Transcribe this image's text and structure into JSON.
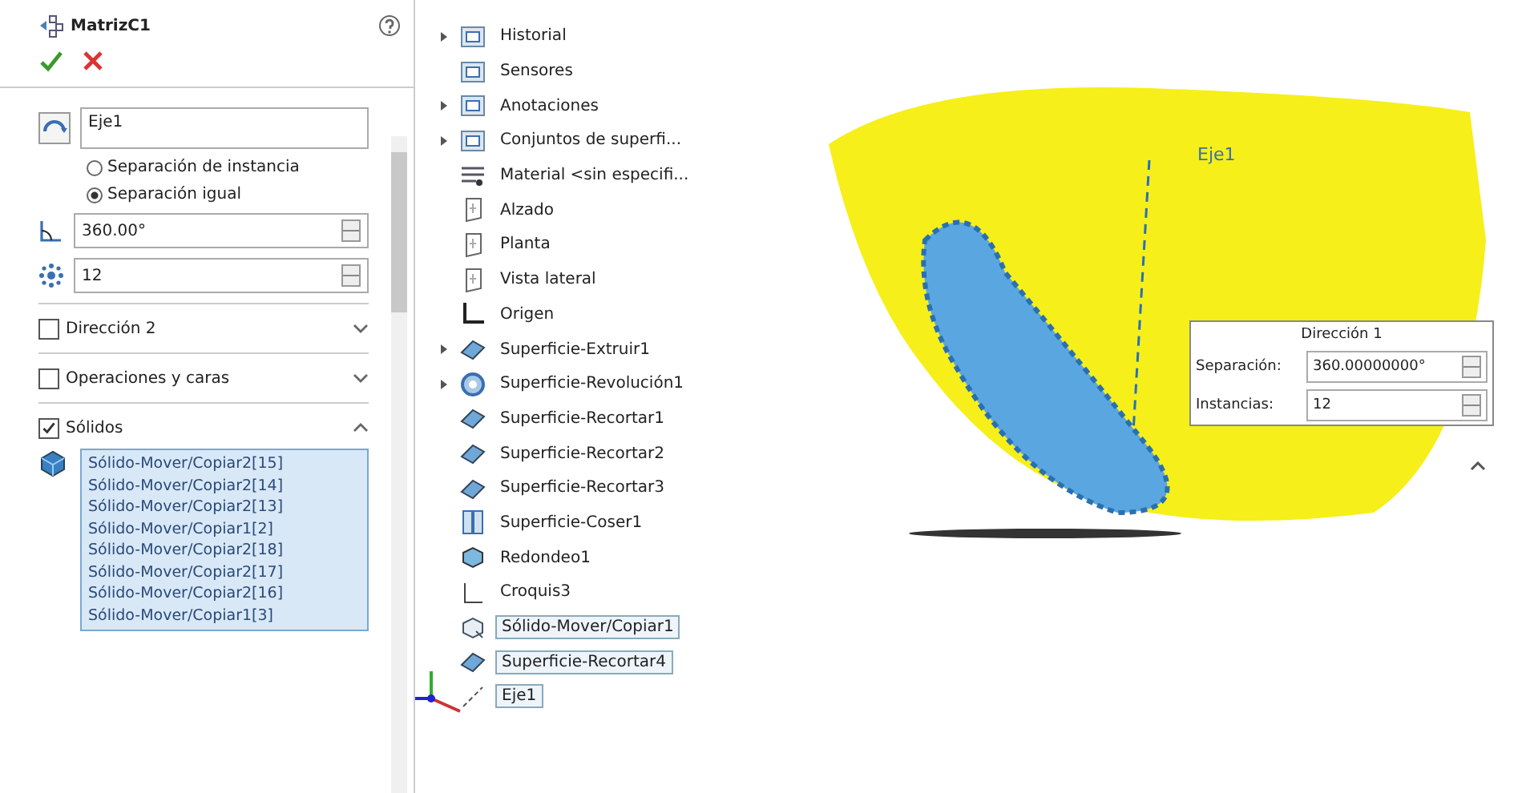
{
  "panel": {
    "title": "MatrizC1",
    "axis_field": {
      "value": "Eje1"
    },
    "radios": [
      {
        "label": "Separación de instancia",
        "selected": false
      },
      {
        "label": "Separación igual",
        "selected": true
      }
    ],
    "angle_field": {
      "value": "360.00°"
    },
    "count_field": {
      "value": "12"
    },
    "sections": [
      {
        "label": "Dirección 2",
        "checked": false,
        "expanded": false
      },
      {
        "label": "Operaciones y caras",
        "checked": false,
        "expanded": false
      },
      {
        "label": "Sólidos",
        "checked": true,
        "expanded": true
      }
    ],
    "solids": [
      "Sólido-Mover/Copiar2[15]",
      "Sólido-Mover/Copiar2[14]",
      "Sólido-Mover/Copiar2[13]",
      "Sólido-Mover/Copiar1[2]",
      "Sólido-Mover/Copiar2[18]",
      "Sólido-Mover/Copiar2[17]",
      "Sólido-Mover/Copiar2[16]",
      "Sólido-Mover/Copiar1[3]"
    ]
  },
  "tree": [
    {
      "label": "Historial",
      "kind": "folder",
      "expandable": true,
      "selected": false
    },
    {
      "label": "Sensores",
      "kind": "folder",
      "expandable": false,
      "selected": false
    },
    {
      "label": "Anotaciones",
      "kind": "folder",
      "expandable": true,
      "selected": false
    },
    {
      "label": "Conjuntos de superfi...",
      "kind": "folder",
      "expandable": true,
      "selected": false
    },
    {
      "label": "Material <sin especifi...",
      "kind": "material",
      "expandable": false,
      "selected": false
    },
    {
      "label": "Alzado",
      "kind": "plane",
      "expandable": false,
      "selected": false
    },
    {
      "label": "Planta",
      "kind": "plane",
      "expandable": false,
      "selected": false
    },
    {
      "label": "Vista lateral",
      "kind": "plane",
      "expandable": false,
      "selected": false
    },
    {
      "label": "Origen",
      "kind": "origin",
      "expandable": false,
      "selected": false
    },
    {
      "label": "Superficie-Extruir1",
      "kind": "surface",
      "expandable": true,
      "selected": false
    },
    {
      "label": "Superficie-Revolución1",
      "kind": "revolve",
      "expandable": true,
      "selected": false
    },
    {
      "label": "Superficie-Recortar1",
      "kind": "surface",
      "expandable": false,
      "selected": false
    },
    {
      "label": "Superficie-Recortar2",
      "kind": "surface",
      "expandable": false,
      "selected": false
    },
    {
      "label": "Superficie-Recortar3",
      "kind": "surface",
      "expandable": false,
      "selected": false
    },
    {
      "label": "Superficie-Coser1",
      "kind": "knit",
      "expandable": false,
      "selected": false
    },
    {
      "label": "Redondeo1",
      "kind": "fillet",
      "expandable": false,
      "selected": false
    },
    {
      "label": "Croquis3",
      "kind": "sketch",
      "expandable": false,
      "selected": false
    },
    {
      "label": "Sólido-Mover/Copiar1",
      "kind": "move",
      "expandable": false,
      "selected": true
    },
    {
      "label": "Superficie-Recortar4",
      "kind": "surface",
      "expandable": false,
      "selected": true
    },
    {
      "label": "Eje1",
      "kind": "axis",
      "expandable": false,
      "selected": true
    }
  ],
  "viewport": {
    "axis_label": "Eje1",
    "callout": {
      "title": "Dirección 1",
      "rows": [
        {
          "label": "Separación:",
          "value": "360.00000000°"
        },
        {
          "label": "Instancias:",
          "value": "12"
        }
      ]
    }
  }
}
